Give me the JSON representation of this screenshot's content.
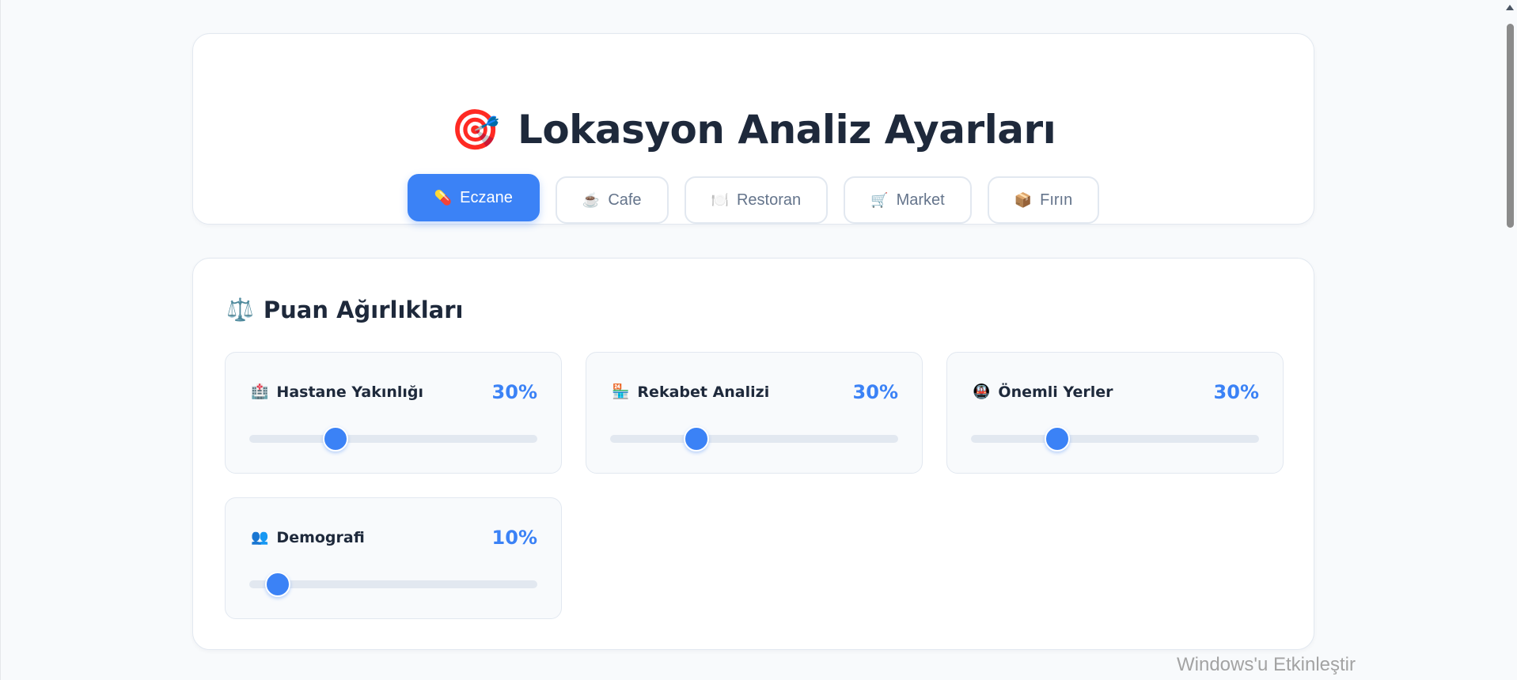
{
  "header": {
    "icon": "🎯",
    "icon_name": "target-icon",
    "title": "Lokasyon Analiz Ayarları"
  },
  "tabs": [
    {
      "icon": "💊",
      "label": "Eczane",
      "active": true
    },
    {
      "icon": "☕",
      "label": "Cafe",
      "active": false
    },
    {
      "icon": "🍽️",
      "label": "Restoran",
      "active": false
    },
    {
      "icon": "🛒",
      "label": "Market",
      "active": false
    },
    {
      "icon": "📦",
      "label": "Fırın",
      "active": false
    }
  ],
  "weights": {
    "icon": "⚖️",
    "title": "Puan Ağırlıkları",
    "items": [
      {
        "icon": "🏥",
        "label": "Hastane Yakınlığı",
        "value_text": "30%",
        "value": 30
      },
      {
        "icon": "🏪",
        "label": "Rekabet Analizi",
        "value_text": "30%",
        "value": 30
      },
      {
        "icon": "🚇",
        "label": "Önemli Yerler",
        "value_text": "30%",
        "value": 30
      },
      {
        "icon": "👥",
        "label": "Demografi",
        "value_text": "10%",
        "value": 10
      }
    ]
  },
  "watermark": "Windows'u Etkinleştir",
  "colors": {
    "accent": "#3b82f6",
    "text": "#1e293b",
    "muted": "#64748b",
    "border": "#e2e8f0",
    "background": "#f8fafc"
  }
}
